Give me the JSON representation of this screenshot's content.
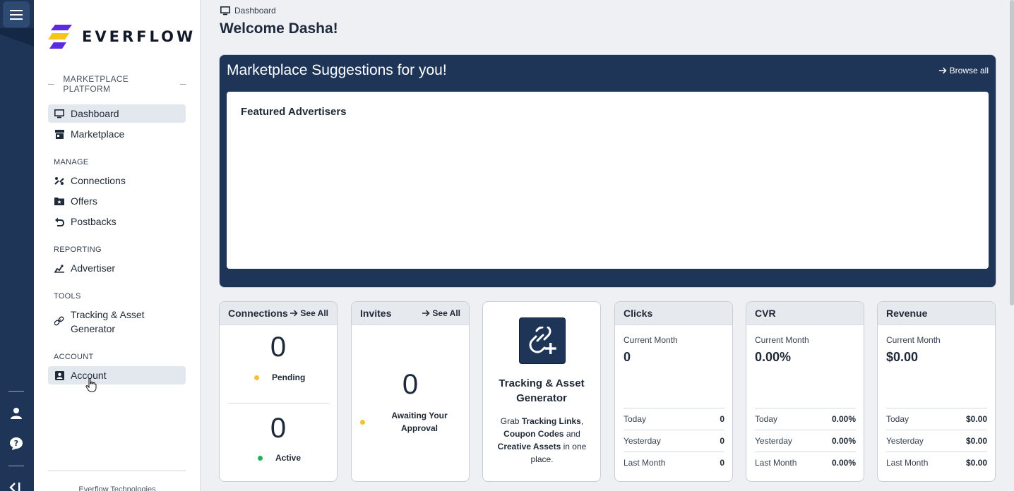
{
  "brand": {
    "name": "EVERFLOW",
    "colors": {
      "navy": "#1e3558",
      "accent_yellow": "#f5c518",
      "accent_purple": "#5b2be0",
      "pending": "#f2c230",
      "active": "#22b25a"
    }
  },
  "rail": {
    "icons": [
      "hamburger-menu-icon",
      "user-icon",
      "help-chat-icon",
      "collapse-icon"
    ]
  },
  "sidebar": {
    "platform_label": "MARKETPLACE PLATFORM",
    "items_top": [
      {
        "label": "Dashboard",
        "icon": "monitor-icon",
        "active": true
      },
      {
        "label": "Marketplace",
        "icon": "store-icon",
        "active": false
      }
    ],
    "sections": {
      "manage": "MANAGE",
      "reporting": "REPORTING",
      "tools": "TOOLS",
      "account": "ACCOUNT"
    },
    "manage_items": [
      "Connections",
      "Offers",
      "Postbacks"
    ],
    "reporting_items": [
      "Advertiser"
    ],
    "tools_items": [
      "Tracking & Asset Generator"
    ],
    "account_items": [
      "Account"
    ],
    "footer": "Everflow Technologies"
  },
  "header": {
    "breadcrumb": "Dashboard",
    "welcome": "Welcome Dasha!"
  },
  "marketplace": {
    "title": "Marketplace Suggestions for you!",
    "browse_all": "Browse all",
    "featured_title": "Featured Advertisers"
  },
  "cards": {
    "connections": {
      "title": "Connections",
      "see_all": "See All",
      "pending_count": "0",
      "pending_label": "Pending",
      "active_count": "0",
      "active_label": "Active"
    },
    "invites": {
      "title": "Invites",
      "see_all": "See All",
      "count": "0",
      "label": "Awaiting Your Approval"
    },
    "tracking": {
      "title": "Tracking & Asset Generator",
      "desc_1": "Grab ",
      "desc_b1": "Tracking Links",
      "desc_2": ", ",
      "desc_b2": "Coupon Codes",
      "desc_3": " and ",
      "desc_b3": "Creative Assets",
      "desc_4": " in one place."
    },
    "clicks": {
      "title": "Clicks",
      "sub": "Current Month",
      "value": "0",
      "rows": [
        {
          "label": "Today",
          "value": "0"
        },
        {
          "label": "Yesterday",
          "value": "0"
        },
        {
          "label": "Last Month",
          "value": "0"
        }
      ]
    },
    "cvr": {
      "title": "CVR",
      "sub": "Current Month",
      "value": "0.00%",
      "rows": [
        {
          "label": "Today",
          "value": "0.00%"
        },
        {
          "label": "Yesterday",
          "value": "0.00%"
        },
        {
          "label": "Last Month",
          "value": "0.00%"
        }
      ]
    },
    "revenue": {
      "title": "Revenue",
      "sub": "Current Month",
      "value": "$0.00",
      "rows": [
        {
          "label": "Today",
          "value": "$0.00"
        },
        {
          "label": "Yesterday",
          "value": "$0.00"
        },
        {
          "label": "Last Month",
          "value": "$0.00"
        }
      ]
    }
  }
}
